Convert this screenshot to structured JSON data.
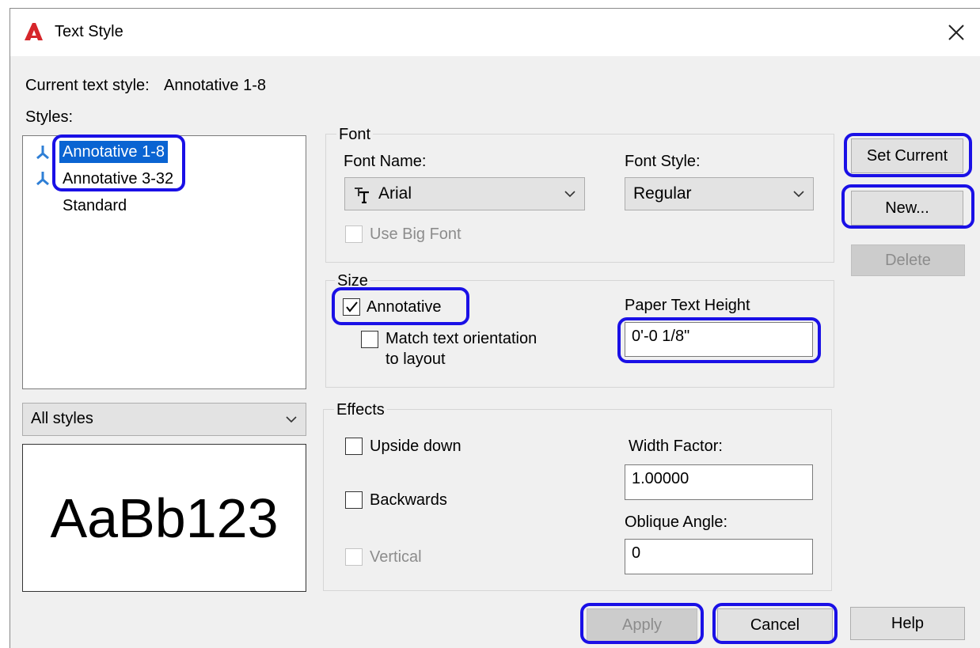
{
  "window": {
    "title": "Text Style",
    "app_icon": "autocad-a-icon",
    "close_icon": "close-icon"
  },
  "current_style": {
    "label": "Current text style:",
    "value": "Annotative 1-8"
  },
  "styles": {
    "label": "Styles:",
    "items": [
      {
        "name": "Annotative 1-8",
        "annotative": true,
        "selected": true
      },
      {
        "name": "Annotative 3-32",
        "annotative": true,
        "selected": false
      },
      {
        "name": "Standard",
        "annotative": false,
        "selected": false
      }
    ],
    "filter_value": "All styles"
  },
  "preview": {
    "text": "AaBb123"
  },
  "font": {
    "group_title": "Font",
    "font_name_label": "Font Name:",
    "font_name_value": "Arial",
    "font_style_label": "Font Style:",
    "font_style_value": "Regular",
    "use_big_font_label": "Use Big Font",
    "use_big_font_checked": false
  },
  "size": {
    "group_title": "Size",
    "annotative_label": "Annotative",
    "annotative_checked": true,
    "match_label_line1": "Match text orientation",
    "match_label_line2": "to layout",
    "match_checked": false,
    "paper_height_label": "Paper Text Height",
    "paper_height_value": "0'-0 1/8\""
  },
  "effects": {
    "group_title": "Effects",
    "upside_down_label": "Upside down",
    "backwards_label": "Backwards",
    "vertical_label": "Vertical",
    "width_factor_label": "Width Factor:",
    "width_factor_value": "1.00000",
    "oblique_label": "Oblique Angle:",
    "oblique_value": "0"
  },
  "buttons": {
    "set_current": "Set Current",
    "new": "New...",
    "delete": "Delete",
    "apply": "Apply",
    "cancel": "Cancel",
    "help": "Help"
  },
  "colors": {
    "highlight": "#1a10e6",
    "selection": "#0a64d2",
    "brand_red": "#d6262b",
    "annotative_icon": "#2f7fd6"
  }
}
